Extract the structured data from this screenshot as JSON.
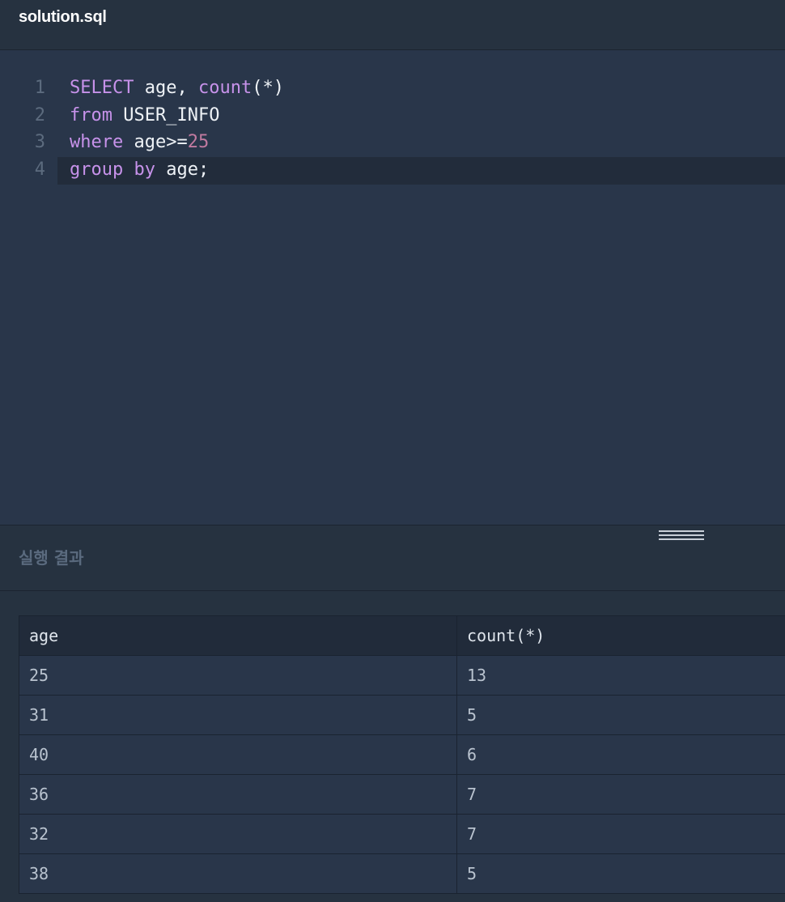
{
  "file": {
    "name": "solution.sql"
  },
  "editor": {
    "lines": [
      {
        "no": "1",
        "tokens": [
          {
            "t": "kw",
            "v": "SELECT"
          },
          {
            "t": "plain",
            "v": " age, "
          },
          {
            "t": "fn",
            "v": "count"
          },
          {
            "t": "plain",
            "v": "(*)"
          }
        ]
      },
      {
        "no": "2",
        "tokens": [
          {
            "t": "kw",
            "v": "from"
          },
          {
            "t": "plain",
            "v": " USER_INFO"
          }
        ]
      },
      {
        "no": "3",
        "tokens": [
          {
            "t": "kw",
            "v": "where"
          },
          {
            "t": "plain",
            "v": " age>="
          },
          {
            "t": "num",
            "v": "25"
          }
        ]
      },
      {
        "no": "4",
        "tokens": [
          {
            "t": "kw",
            "v": "group by"
          },
          {
            "t": "plain",
            "v": " age;"
          }
        ]
      }
    ]
  },
  "result": {
    "title": "실행 결과",
    "columns": [
      "age",
      "count(*)"
    ],
    "rows": [
      [
        "25",
        "13"
      ],
      [
        "31",
        "5"
      ],
      [
        "40",
        "6"
      ],
      [
        "36",
        "7"
      ],
      [
        "32",
        "7"
      ],
      [
        "38",
        "5"
      ]
    ]
  },
  "colors": {
    "keyword": "#c792ea",
    "number": "#c17aa0",
    "text": "#eef2f6"
  }
}
